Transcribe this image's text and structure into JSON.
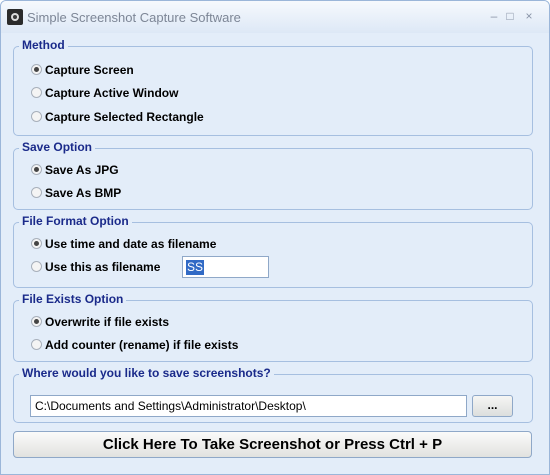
{
  "window": {
    "title": "Simple Screenshot Capture Software",
    "controls": {
      "minimize": "–",
      "maximize": "□",
      "close": "×"
    }
  },
  "method": {
    "title": "Method",
    "options": [
      {
        "label": "Capture Screen",
        "checked": true
      },
      {
        "label": "Capture Active Window",
        "checked": false
      },
      {
        "label": "Capture Selected Rectangle",
        "checked": false
      }
    ]
  },
  "save_option": {
    "title": "Save Option",
    "options": [
      {
        "label": "Save As JPG",
        "checked": true
      },
      {
        "label": "Save As BMP",
        "checked": false
      }
    ]
  },
  "file_format": {
    "title": "File Format Option",
    "options": [
      {
        "label": "Use time and date as filename",
        "checked": true
      },
      {
        "label": "Use this as filename",
        "checked": false
      }
    ],
    "filename_value": "SS"
  },
  "file_exists": {
    "title": "File Exists Option",
    "options": [
      {
        "label": "Overwrite if file exists",
        "checked": true
      },
      {
        "label": "Add counter (rename) if file exists",
        "checked": false
      }
    ]
  },
  "save_location": {
    "title": "Where would you like to save screenshots?",
    "path": "C:\\Documents and Settings\\Administrator\\Desktop\\",
    "browse_label": "..."
  },
  "capture_button": {
    "label": "Click Here To Take Screenshot or Press Ctrl + P"
  }
}
